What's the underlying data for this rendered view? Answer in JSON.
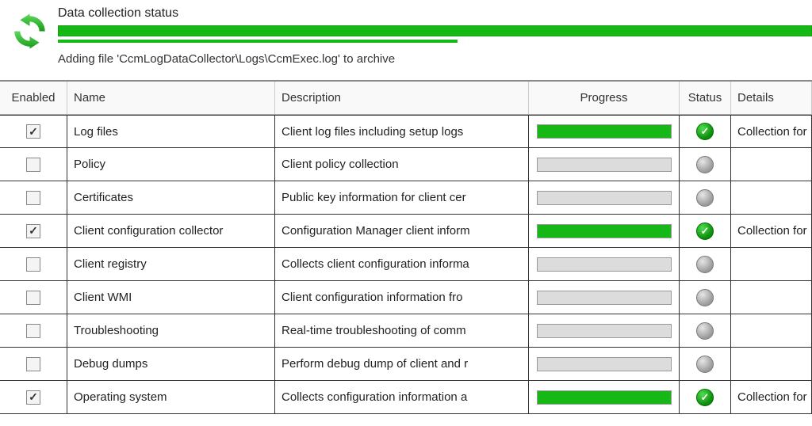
{
  "header": {
    "title": "Data collection status",
    "overall_progress_pct": 100,
    "secondary_progress_pct": 53,
    "sub_status": "Adding file 'CcmLogDataCollector\\Logs\\CcmExec.log' to archive"
  },
  "columns": {
    "enabled": "Enabled",
    "name": "Name",
    "description": "Description",
    "progress": "Progress",
    "status": "Status",
    "details": "Details"
  },
  "rows": [
    {
      "enabled": true,
      "name": "Log files",
      "description": "Client log files including setup logs",
      "progress_pct": 100,
      "status": "ok",
      "details": "Collection for "
    },
    {
      "enabled": false,
      "name": "Policy",
      "description": "Client policy collection",
      "progress_pct": 0,
      "status": "idle",
      "details": ""
    },
    {
      "enabled": false,
      "name": "Certificates",
      "description": "Public key information for client cer",
      "progress_pct": 0,
      "status": "idle",
      "details": ""
    },
    {
      "enabled": true,
      "name": "Client configuration collector",
      "description": "Configuration Manager client inform",
      "progress_pct": 100,
      "status": "ok",
      "details": "Collection for "
    },
    {
      "enabled": false,
      "name": "Client registry",
      "description": "Collects client configuration informa",
      "progress_pct": 0,
      "status": "idle",
      "details": ""
    },
    {
      "enabled": false,
      "name": "Client WMI",
      "description": "Client configuration information fro",
      "progress_pct": 0,
      "status": "idle",
      "details": ""
    },
    {
      "enabled": false,
      "name": "Troubleshooting",
      "description": "Real-time troubleshooting of comm",
      "progress_pct": 0,
      "status": "idle",
      "details": ""
    },
    {
      "enabled": false,
      "name": "Debug dumps",
      "description": "Perform debug dump of client and r",
      "progress_pct": 0,
      "status": "idle",
      "details": ""
    },
    {
      "enabled": true,
      "name": "Operating system",
      "description": "Collects configuration information a",
      "progress_pct": 100,
      "status": "ok",
      "details": "Collection for "
    }
  ],
  "colors": {
    "progress_green": "#16b816",
    "status_ok": "#0a8a0a",
    "status_idle": "#9a9a9a"
  }
}
